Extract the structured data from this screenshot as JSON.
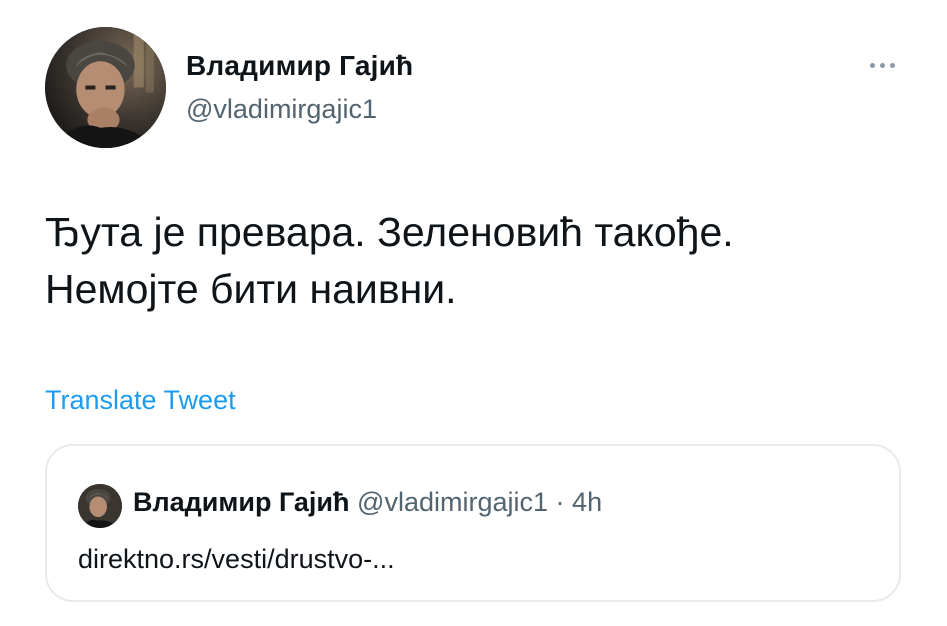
{
  "tweet": {
    "author": {
      "name": "Владимир Гајић",
      "handle": "@vladimirgajic1"
    },
    "text": "Ђута је превара. Зеленовић такође.\nНемојте бити наивни.",
    "translate_label": "Translate Tweet",
    "more_icon": "more-horizontal-icon"
  },
  "quote": {
    "author": {
      "name": "Владимир Гајић",
      "handle": "@vladimirgajic1"
    },
    "separator": "·",
    "time": "4h",
    "text": "direktno.rs/vesti/drustvo-..."
  },
  "colors": {
    "text": "#0f1419",
    "secondary": "#536471",
    "link": "#1d9bf0",
    "border": "#e7eaed"
  }
}
